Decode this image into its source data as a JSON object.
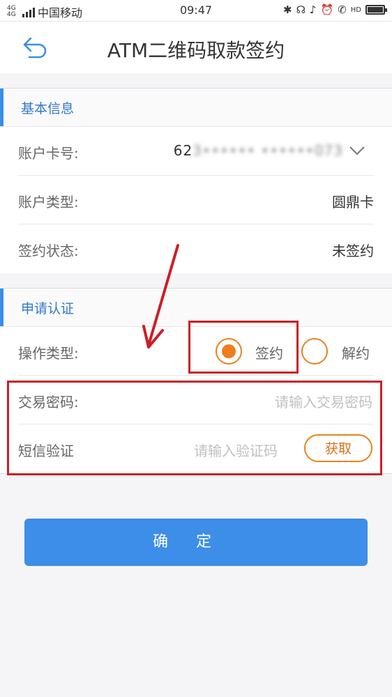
{
  "status_bar": {
    "network_label": "4G 4G",
    "carrier": "中国移动",
    "time": "09:47",
    "hd_label": "HD"
  },
  "nav": {
    "title": "ATM二维码取款签约"
  },
  "basic_info": {
    "section_title": "基本信息",
    "account_number_label": "账户卡号:",
    "account_number_prefix": "62",
    "account_number_masked": "3•••••• ••••••073",
    "account_type_label": "账户类型:",
    "account_type_value": "圆鼎卡",
    "sign_status_label": "签约状态:",
    "sign_status_value": "未签约"
  },
  "auth": {
    "section_title": "申请认证",
    "operation_type_label": "操作类型:",
    "option_sign": "签约",
    "option_unsign": "解约",
    "selected_option": "签约",
    "password_label": "交易密码:",
    "password_placeholder": "请输入交易密码",
    "sms_label": "短信验证",
    "sms_placeholder": "请输入验证码",
    "get_code_label": "获取"
  },
  "confirm_label": "确定",
  "colors": {
    "accent_blue": "#3d8ee8",
    "accent_orange": "#e8821e",
    "annotation_red": "#cc1f26"
  }
}
